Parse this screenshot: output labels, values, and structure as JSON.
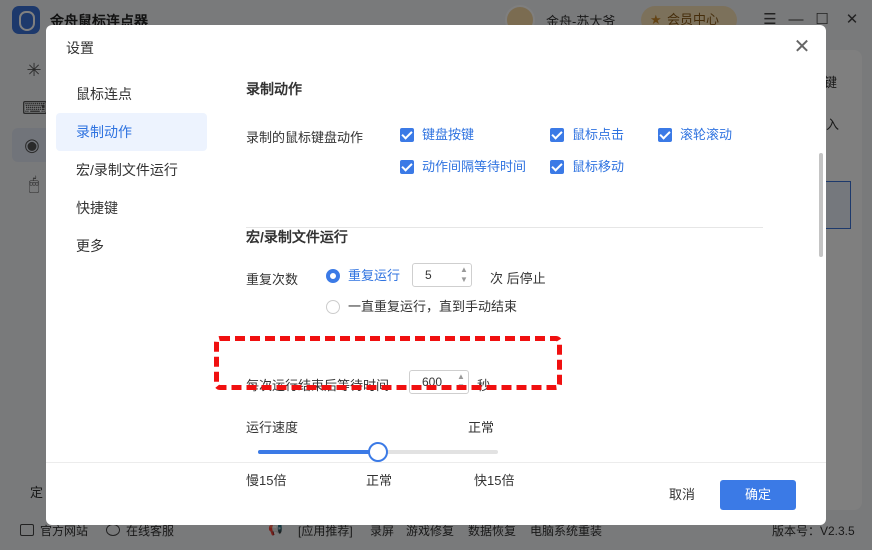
{
  "app": {
    "title": "金舟鼠标连点器",
    "user_name": "金舟-苏大爷",
    "vip_label": "会员中心",
    "window_controls": [
      "menu-icon",
      "minimize-icon",
      "maximize-icon",
      "close-icon"
    ],
    "main_fragment_1": "键",
    "main_fragment_2": "入",
    "side_fragment": "定",
    "footer": {
      "official_site": "官方网站",
      "online_service": "在线客服",
      "recommend": "[应用推荐]",
      "recommend_items": [
        "录屏",
        "游戏修复",
        "数据恢复",
        "电脑系统重装"
      ],
      "version": "版本号：V2.3.5"
    }
  },
  "dialog": {
    "title": "设置",
    "nav": [
      {
        "label": "鼠标连点",
        "active": false
      },
      {
        "label": "录制动作",
        "active": true
      },
      {
        "label": "宏/录制文件运行",
        "active": false
      },
      {
        "label": "快捷键",
        "active": false
      },
      {
        "label": "更多",
        "active": false
      }
    ],
    "record": {
      "section_title": "录制动作",
      "row_label": "录制的鼠标键盘动作",
      "options": [
        {
          "label": "键盘按键",
          "checked": true
        },
        {
          "label": "鼠标点击",
          "checked": true
        },
        {
          "label": "滚轮滚动",
          "checked": true
        },
        {
          "label": "动作间隔等待时间",
          "checked": true
        },
        {
          "label": "鼠标移动",
          "checked": true
        }
      ]
    },
    "macro": {
      "section_title": "宏/录制文件运行",
      "repeat_label": "重复次数",
      "repeat_option": "重复运行",
      "repeat_value": "5",
      "repeat_suffix": "次 后停止",
      "loop_option": "一直重复运行，直到手动结束",
      "wait_label": "每次运行结束后等待时间",
      "wait_value": "600",
      "wait_unit": "秒",
      "speed_label": "运行速度",
      "speed_current": "正常",
      "speed_min": "慢15倍",
      "speed_mid": "正常",
      "speed_max": "快15倍",
      "speed_fraction": 0.5
    },
    "buttons": {
      "cancel": "取消",
      "ok": "确定"
    }
  },
  "colors": {
    "accent": "#3b7ae6",
    "annotation": "#f01010"
  }
}
